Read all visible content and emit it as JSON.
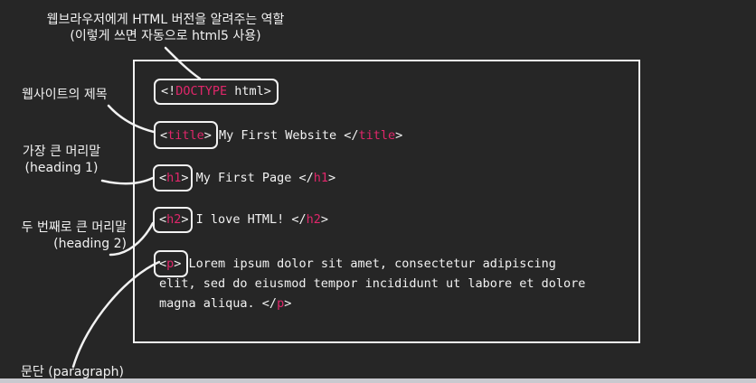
{
  "annotations": {
    "doctype": {
      "line1": "웹브라우저에게 HTML 버전을 알려주는 역할",
      "line2": "(이렇게 쓰면 자동으로 html5 사용)"
    },
    "title": {
      "line1": "웹사이트의 제목"
    },
    "h1": {
      "line1": "가장 큰 머리말",
      "line2": "(heading 1)"
    },
    "h2": {
      "line1": "두 번째로 큰 머리말",
      "line2": "(heading 2)"
    },
    "p": {
      "line1": "문단 (paragraph)"
    }
  },
  "code": {
    "doctype": {
      "open": "<!",
      "keyword": "DOCTYPE",
      "rest": " html>"
    },
    "title": {
      "lt": "<",
      "tag": "title",
      "gt": ">",
      "content": " My First Website ",
      "close_open": "</",
      "close_tag": "title",
      "close_gt": ">"
    },
    "h1": {
      "lt": "<",
      "tag": "h1",
      "gt": ">",
      "content": " My First Page ",
      "close_open": "</",
      "close_tag": "h1",
      "close_gt": ">"
    },
    "h2": {
      "lt": "<",
      "tag": "h2",
      "gt": ">",
      "content": " I love HTML! ",
      "close_open": "</",
      "close_tag": "h2",
      "close_gt": ">"
    },
    "p": {
      "lt": "<",
      "tag": "p",
      "gt": ">",
      "line1": " Lorem ipsum dolor sit amet, consectetur adipiscing",
      "line2": "elit, sed do eiusmod tempor incididunt ut labore et dolore",
      "line3": "magna aliqua. ",
      "close_open": "</",
      "close_tag": "p",
      "close_gt": ">"
    }
  },
  "colors": {
    "background": "#262626",
    "foreground": "#f2f2f2",
    "tag_keyword": "#e0266a"
  }
}
